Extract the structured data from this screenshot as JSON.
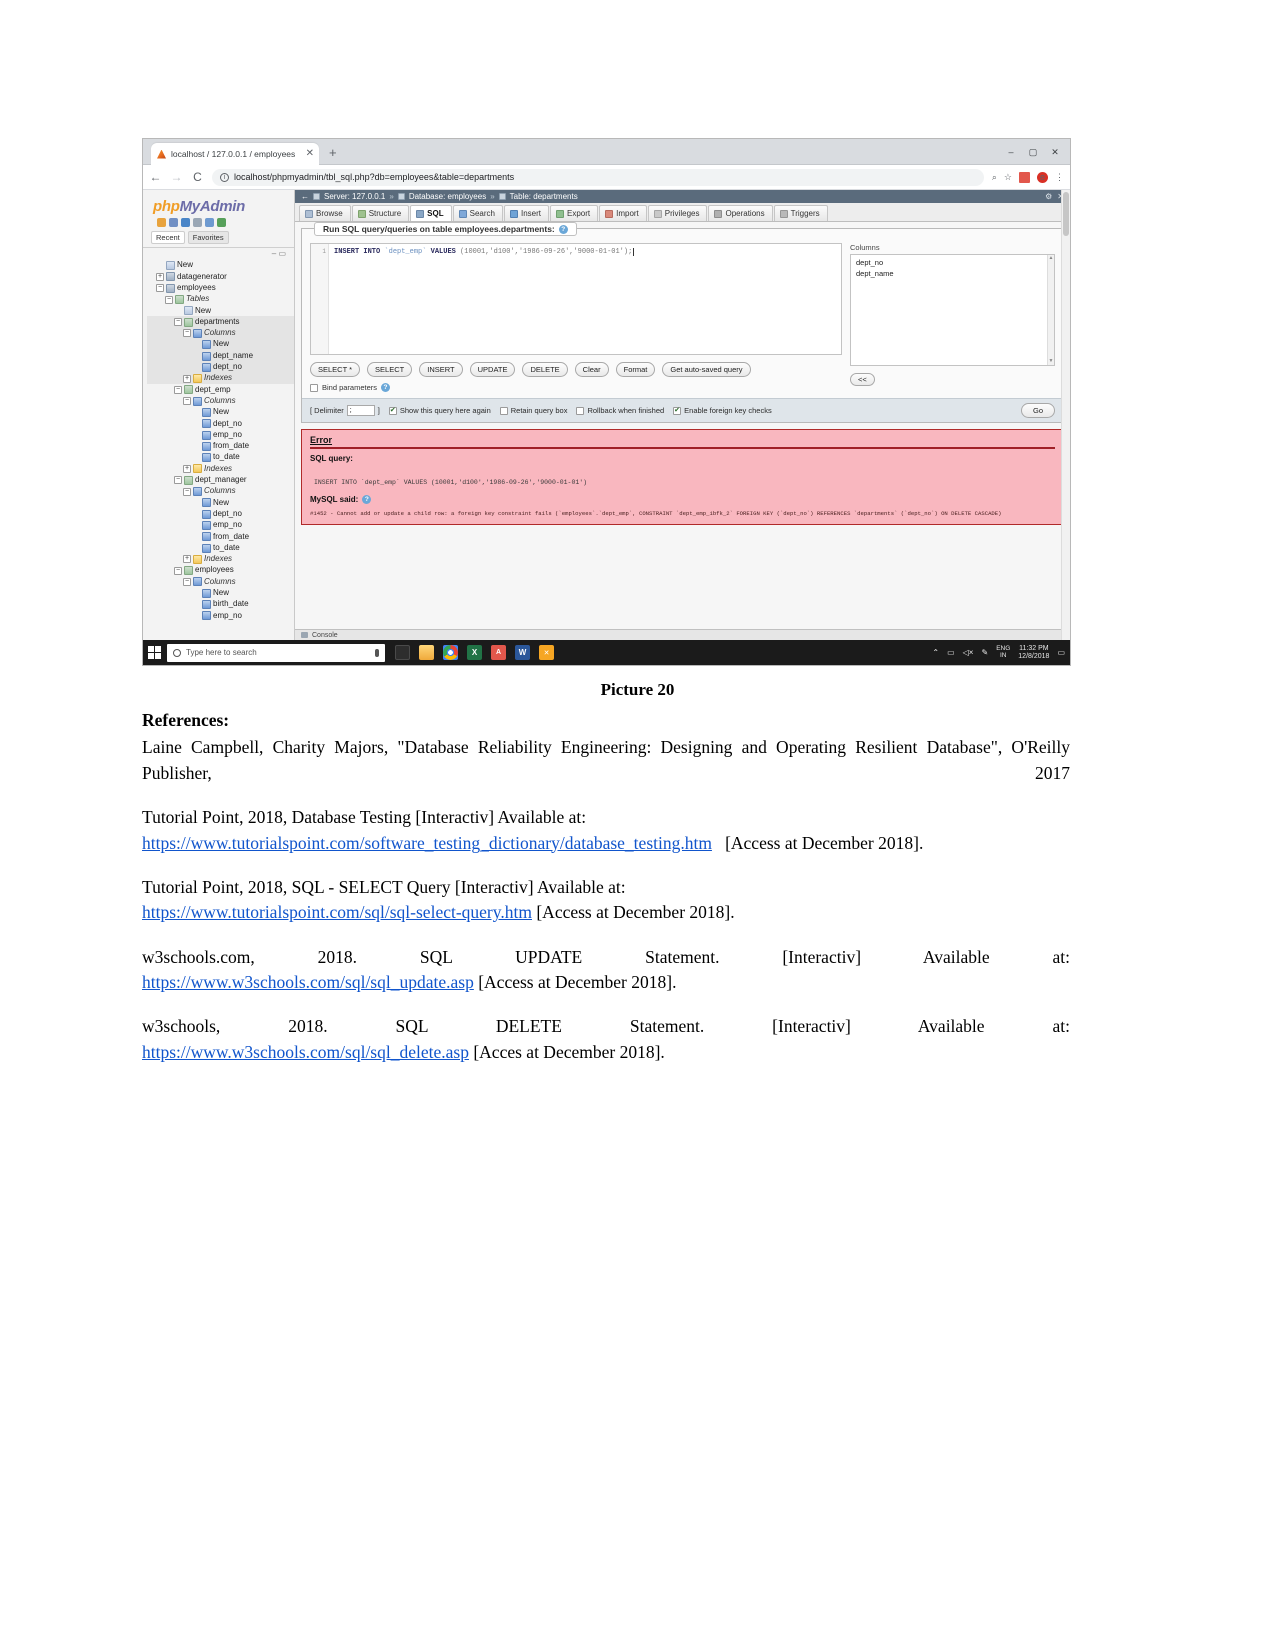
{
  "browser": {
    "tab_title": "localhost / 127.0.0.1 / employees",
    "tab_close": "✕",
    "new_tab": "+",
    "back": "←",
    "forward": "→",
    "reload": "C",
    "info_glyph": "i",
    "url": "localhost/phpmyadmin/tbl_sql.php?db=employees&table=departments",
    "zoom_icon": "⌕",
    "star_icon": "☆",
    "avatar_letter": "e",
    "menu_icon": "⋮",
    "minimize": "–",
    "maximize": "▢",
    "close": "✕"
  },
  "sidebar": {
    "logo_php": "php",
    "logo_myadmin": "MyAdmin",
    "tabs": [
      "Recent",
      "Favorites"
    ],
    "tools": "– ▭",
    "tree": [
      {
        "depth": 1,
        "toggle": "",
        "icon": "ic-new",
        "label": "New",
        "italic": false,
        "selected": false
      },
      {
        "depth": 1,
        "toggle": "+",
        "icon": "ic-db",
        "label": "datagenerator",
        "italic": false,
        "selected": false
      },
      {
        "depth": 1,
        "toggle": "−",
        "icon": "ic-db",
        "label": "employees",
        "italic": false,
        "selected": false
      },
      {
        "depth": 2,
        "toggle": "−",
        "icon": "ic-tbl",
        "label": "Tables",
        "italic": true,
        "selected": false
      },
      {
        "depth": 3,
        "toggle": "",
        "icon": "ic-new",
        "label": "New",
        "italic": false,
        "selected": false
      },
      {
        "depth": 3,
        "toggle": "−",
        "icon": "ic-tbl",
        "label": "departments",
        "italic": false,
        "selected": true
      },
      {
        "depth": 4,
        "toggle": "−",
        "icon": "ic-col",
        "label": "Columns",
        "italic": true,
        "selected": true
      },
      {
        "depth": 5,
        "toggle": "",
        "icon": "ic-col",
        "label": "New",
        "italic": false,
        "selected": true
      },
      {
        "depth": 5,
        "toggle": "",
        "icon": "ic-col",
        "label": "dept_name",
        "italic": false,
        "selected": true
      },
      {
        "depth": 5,
        "toggle": "",
        "icon": "ic-col",
        "label": "dept_no",
        "italic": false,
        "selected": true
      },
      {
        "depth": 4,
        "toggle": "+",
        "icon": "ic-idx",
        "label": "Indexes",
        "italic": true,
        "selected": true
      },
      {
        "depth": 3,
        "toggle": "−",
        "icon": "ic-tbl",
        "label": "dept_emp",
        "italic": false,
        "selected": false
      },
      {
        "depth": 4,
        "toggle": "−",
        "icon": "ic-col",
        "label": "Columns",
        "italic": true,
        "selected": false
      },
      {
        "depth": 5,
        "toggle": "",
        "icon": "ic-col",
        "label": "New",
        "italic": false,
        "selected": false
      },
      {
        "depth": 5,
        "toggle": "",
        "icon": "ic-col",
        "label": "dept_no",
        "italic": false,
        "selected": false
      },
      {
        "depth": 5,
        "toggle": "",
        "icon": "ic-col",
        "label": "emp_no",
        "italic": false,
        "selected": false
      },
      {
        "depth": 5,
        "toggle": "",
        "icon": "ic-col",
        "label": "from_date",
        "italic": false,
        "selected": false
      },
      {
        "depth": 5,
        "toggle": "",
        "icon": "ic-col",
        "label": "to_date",
        "italic": false,
        "selected": false
      },
      {
        "depth": 4,
        "toggle": "+",
        "icon": "ic-idx",
        "label": "Indexes",
        "italic": true,
        "selected": false
      },
      {
        "depth": 3,
        "toggle": "−",
        "icon": "ic-tbl",
        "label": "dept_manager",
        "italic": false,
        "selected": false
      },
      {
        "depth": 4,
        "toggle": "−",
        "icon": "ic-col",
        "label": "Columns",
        "italic": true,
        "selected": false
      },
      {
        "depth": 5,
        "toggle": "",
        "icon": "ic-col",
        "label": "New",
        "italic": false,
        "selected": false
      },
      {
        "depth": 5,
        "toggle": "",
        "icon": "ic-col",
        "label": "dept_no",
        "italic": false,
        "selected": false
      },
      {
        "depth": 5,
        "toggle": "",
        "icon": "ic-col",
        "label": "emp_no",
        "italic": false,
        "selected": false
      },
      {
        "depth": 5,
        "toggle": "",
        "icon": "ic-col",
        "label": "from_date",
        "italic": false,
        "selected": false
      },
      {
        "depth": 5,
        "toggle": "",
        "icon": "ic-col",
        "label": "to_date",
        "italic": false,
        "selected": false
      },
      {
        "depth": 4,
        "toggle": "+",
        "icon": "ic-idx",
        "label": "Indexes",
        "italic": true,
        "selected": false
      },
      {
        "depth": 3,
        "toggle": "−",
        "icon": "ic-tbl",
        "label": "employees",
        "italic": false,
        "selected": false
      },
      {
        "depth": 4,
        "toggle": "−",
        "icon": "ic-col",
        "label": "Columns",
        "italic": true,
        "selected": false
      },
      {
        "depth": 5,
        "toggle": "",
        "icon": "ic-col",
        "label": "New",
        "italic": false,
        "selected": false
      },
      {
        "depth": 5,
        "toggle": "",
        "icon": "ic-col",
        "label": "birth_date",
        "italic": false,
        "selected": false
      },
      {
        "depth": 5,
        "toggle": "",
        "icon": "ic-col",
        "label": "emp_no",
        "italic": false,
        "selected": false
      }
    ]
  },
  "breadcrumb": {
    "server": "Server: 127.0.0.1",
    "database": "Database: employees",
    "table": "Table: departments",
    "sep": "»",
    "collapse": "←",
    "gear": "⚙",
    "close": "✕"
  },
  "tabs": [
    {
      "label": "Browse",
      "icon": "ti-browse",
      "active": false
    },
    {
      "label": "Structure",
      "icon": "ti-struct",
      "active": false
    },
    {
      "label": "SQL",
      "icon": "ti-sql",
      "active": true
    },
    {
      "label": "Search",
      "icon": "ti-search",
      "active": false
    },
    {
      "label": "Insert",
      "icon": "ti-insert",
      "active": false
    },
    {
      "label": "Export",
      "icon": "ti-export",
      "active": false
    },
    {
      "label": "Import",
      "icon": "ti-import",
      "active": false
    },
    {
      "label": "Privileges",
      "icon": "ti-priv",
      "active": false
    },
    {
      "label": "Operations",
      "icon": "ti-op",
      "active": false
    },
    {
      "label": "Triggers",
      "icon": "ti-trig",
      "active": false
    }
  ],
  "sql_panel": {
    "heading": "Run SQL query/queries on table employees.departments:",
    "help_glyph": "?",
    "line_number": "1",
    "query_kw1": "INSERT INTO ",
    "query_id": "`dept_emp`",
    "query_kw2": " VALUES ",
    "query_rest": "(10001,'d100','1986-09-26','9000-01-01');",
    "buttons": [
      "SELECT *",
      "SELECT",
      "INSERT",
      "UPDATE",
      "DELETE",
      "Clear",
      "Format",
      "Get auto-saved query"
    ],
    "bind_parameters_label": "Bind parameters",
    "bind_parameters_checked": false,
    "columns_header": "Columns",
    "columns": [
      "dept_no",
      "dept_name"
    ],
    "collapse_button": "<<"
  },
  "options_bar": {
    "delimiter_open": "[ Delimiter",
    "delimiter_value": ";",
    "delimiter_close": "]",
    "checks": [
      {
        "label": "Show this query here again",
        "checked": true
      },
      {
        "label": "Retain query box",
        "checked": false
      },
      {
        "label": "Rollback when finished",
        "checked": false
      },
      {
        "label": "Enable foreign key checks",
        "checked": true
      }
    ],
    "go_label": "Go"
  },
  "error": {
    "title": "Error",
    "sql_query_label": "SQL query:",
    "query_text": "INSERT INTO `dept_emp` VALUES (10001,'d100','1986-09-26','9000-01-01')",
    "mysql_said_label": "MySQL said:",
    "help_glyph": "?",
    "detail": "#1452 - Cannot add or update a child row: a foreign key constraint fails (`employees`.`dept_emp`, CONSTRAINT `dept_emp_ibfk_2` FOREIGN KEY (`dept_no`) REFERENCES `departments` (`dept_no`) ON DELETE CASCADE)"
  },
  "console": {
    "label": "Console"
  },
  "taskbar": {
    "search_placeholder": "Type here to search",
    "apps": [
      {
        "name": "task-view-icon",
        "cls": "tb-task",
        "glyph": ""
      },
      {
        "name": "file-explorer-icon",
        "cls": "tb-folder",
        "glyph": ""
      },
      {
        "name": "chrome-icon",
        "cls": "tb-chrome",
        "glyph": ""
      },
      {
        "name": "excel-icon",
        "cls": "tb-excel",
        "glyph": "X"
      },
      {
        "name": "pdf-icon",
        "cls": "tb-pdf",
        "glyph": "A"
      },
      {
        "name": "word-icon",
        "cls": "tb-word",
        "glyph": "W"
      },
      {
        "name": "xampp-icon",
        "cls": "tb-pma",
        "glyph": "✕"
      }
    ],
    "tray_icons": [
      "⌃",
      "▭",
      "◁×",
      "✎"
    ],
    "lang_line1": "ENG",
    "lang_line2": "IN",
    "time": "11:32 PM",
    "date": "12/8/2018",
    "notification": "▭"
  },
  "caption": "Picture 20",
  "document": {
    "references_heading": "References:",
    "ref1": "Laine Campbell, Charity Majors, \"Database Reliability Engineering: Designing and Operating Resilient Database\", O'Reilly Publisher, 2017",
    "ref2_intro": "Tutorial Point, 2018, Database Testing [Interactiv] Available at:",
    "ref2_link": "https://www.tutorialspoint.com/software_testing_dictionary/database_testing.htm",
    "ref2_tail": "[Access at December 2018].",
    "ref3_intro": "Tutorial Point, 2018, SQL - SELECT Query [Interactiv] Available at:",
    "ref3_link": "https://www.tutorialspoint.com/sql/sql-select-query.htm",
    "ref3_tail": "[Access at December 2018].",
    "ref4_intro": "w3schools.com, 2018. SQL UPDATE Statement. [Interactiv] Available at:",
    "ref4_link": "https://www.w3schools.com/sql/sql_update.asp",
    "ref4_tail": "[Access at December 2018].",
    "ref5_intro": "w3schools, 2018. SQL DELETE Statement. [Interactiv] Available at:",
    "ref5_link": "https://www.w3schools.com/sql/sql_delete.asp",
    "ref5_tail": "[Acces at December  2018]."
  }
}
